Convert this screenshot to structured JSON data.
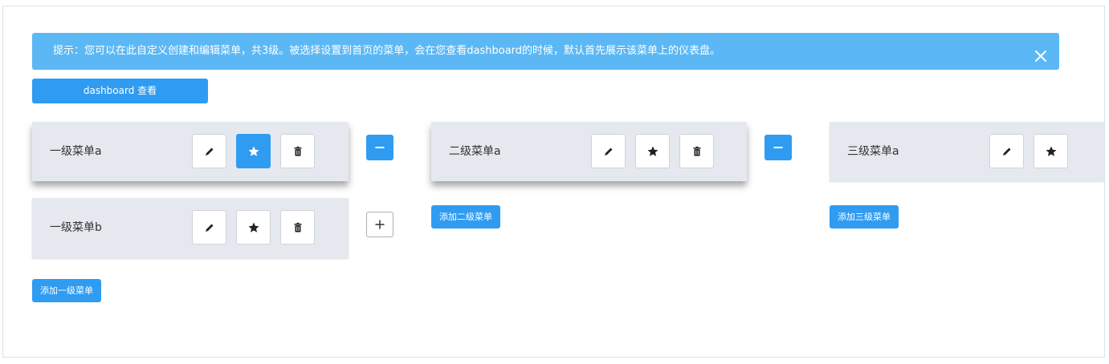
{
  "alert": {
    "message": "提示：您可以在此自定义创建和编辑菜单，共3级。被选择设置到首页的菜单，会在您查看dashboard的时候，默认首先展示该菜单上的仪表盘。",
    "close_icon": "close-icon"
  },
  "dashboard_button": {
    "label": "dashboard 查看"
  },
  "level1": {
    "items": [
      {
        "label": "一级菜单a",
        "starred": true,
        "expanded": true
      },
      {
        "label": "一级菜单b",
        "starred": false,
        "expanded": false
      }
    ],
    "add_label": "添加一级菜单"
  },
  "level2": {
    "items": [
      {
        "label": "二级菜单a",
        "starred": false,
        "expanded": true
      }
    ],
    "add_label": "添加二级菜单"
  },
  "level3": {
    "items": [
      {
        "label": "三级菜单a",
        "starred": false
      }
    ],
    "add_label": "添加三级菜单"
  },
  "colors": {
    "primary": "#2f9cf2",
    "alert_bg": "#5cb8f5",
    "card_bg": "#e5e9ef"
  },
  "icons": [
    "edit-icon",
    "star-icon",
    "trash-icon",
    "minus-icon",
    "plus-icon",
    "close-icon"
  ]
}
